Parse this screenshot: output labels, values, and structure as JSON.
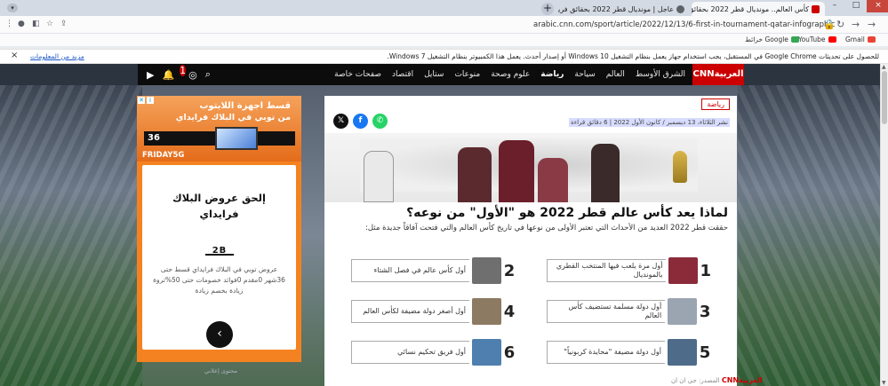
{
  "browser": {
    "tabs": [
      {
        "title": "عاجل | مونديال قطر 2022 بحقائق فريدة...",
        "favicon_color": "#5f6368",
        "active": false
      },
      {
        "title": "كأس العالم.. مونديال قطر 2022 بحقائق ثناء",
        "favicon_color": "#cc0000",
        "active": true
      }
    ],
    "tab_close_glyph": "×",
    "new_tab_glyph": "+",
    "url": "arabic.cnn.com/sport/article/2022/12/13/6-first-in-tournament-qatar-infographic",
    "window_buttons": [
      "–",
      "□",
      "×"
    ],
    "bookmarks": [
      {
        "label": "Gmail",
        "icon_color": "#ea4335"
      },
      {
        "label": "YouTube",
        "icon_color": "#ff0000"
      },
      {
        "label": "خرائط Google",
        "icon_color": "#34a853"
      }
    ],
    "infobar_text": "للحصول على تحديثات Google Chrome في المستقبل، يجب استخدام جهاز يعمل بنظام التشغيل 10 Windows أو إصدار أحدث. يعمل هذا الكمبيوتر بنظام التشغيل 7 Windows.",
    "infobar_link": "مزيد من المعلومات",
    "infobar_close": "×"
  },
  "site": {
    "logo": "CNNالعربية",
    "nav": [
      {
        "label": "الشرق الأوسط",
        "active": false
      },
      {
        "label": "العالم",
        "active": false
      },
      {
        "label": "سياحة",
        "active": false
      },
      {
        "label": "رياضة",
        "active": true
      },
      {
        "label": "علوم وصحة",
        "active": false
      },
      {
        "label": "منوعات",
        "active": false
      },
      {
        "label": "ستايل",
        "active": false
      },
      {
        "label": "اقتصاد",
        "active": false
      },
      {
        "label": "صفحات خاصة",
        "active": false
      }
    ],
    "notification_count": "1",
    "brand_red": "#cc0000"
  },
  "ad": {
    "title_line1": "قسط اجهزة اللابتوب",
    "title_line2": "من توبي في البلاك فرايداي",
    "promo_strip": "36",
    "friday_label": "FRIDAY5G",
    "headline_line1": "إلحق عروض البلاك",
    "headline_line2": "فرايداي",
    "brand_mark": "2B",
    "desc": "عروض توبي في البلاك فرايداي قسط حتى 36شهر 0مقدم 0فوائد خصومات حتى 50%تروة زيادة بخصم زيادة",
    "cta_glyph": "‹",
    "close_glyph": "✕",
    "info_glyph": "i",
    "footer": "محتوى إعلاني"
  },
  "article": {
    "section_tag": "رياضة",
    "meta": "نشر الثلاثاء، 13 ديسمبر / كانون الأول 2022 | 6 دقائق قراءة",
    "title": "لماذا يعد كأس عالم قطر 2022 هو \"الأول\" من نوعه؟",
    "lead": "حققت قطر 2022 العديد من الأحداث التي تعتبر الأولى من نوعها في تاريخ كأس العالم والتي فتحت آفاقاً جديدة مثل:",
    "items": [
      {
        "num": "1",
        "text": "أول مرة يلعب فيها المنتخب القطري بالمونديال",
        "thumb_color": "#8b2b3a"
      },
      {
        "num": "2",
        "text": "أول كأس عالم في فصل الشتاء",
        "thumb_color": "#6f6f6f"
      },
      {
        "num": "3",
        "text": "أول دولة مسلمة تستضيف كأس العالم",
        "thumb_color": "#9aa5b1"
      },
      {
        "num": "4",
        "text": "أول أصغر دولة مضيفة لكأس العالم",
        "thumb_color": "#8d7a62"
      },
      {
        "num": "5",
        "text": "أول دولة مضيفة \"محايدة كربونياً\"",
        "thumb_color": "#4e6b8a"
      },
      {
        "num": "6",
        "text": "أول فريق تحكيم نسائي",
        "thumb_color": "#4f7fae"
      }
    ],
    "footer_brand": "CNNالعربية",
    "footer_note": "المصدر: جي ان ان"
  }
}
